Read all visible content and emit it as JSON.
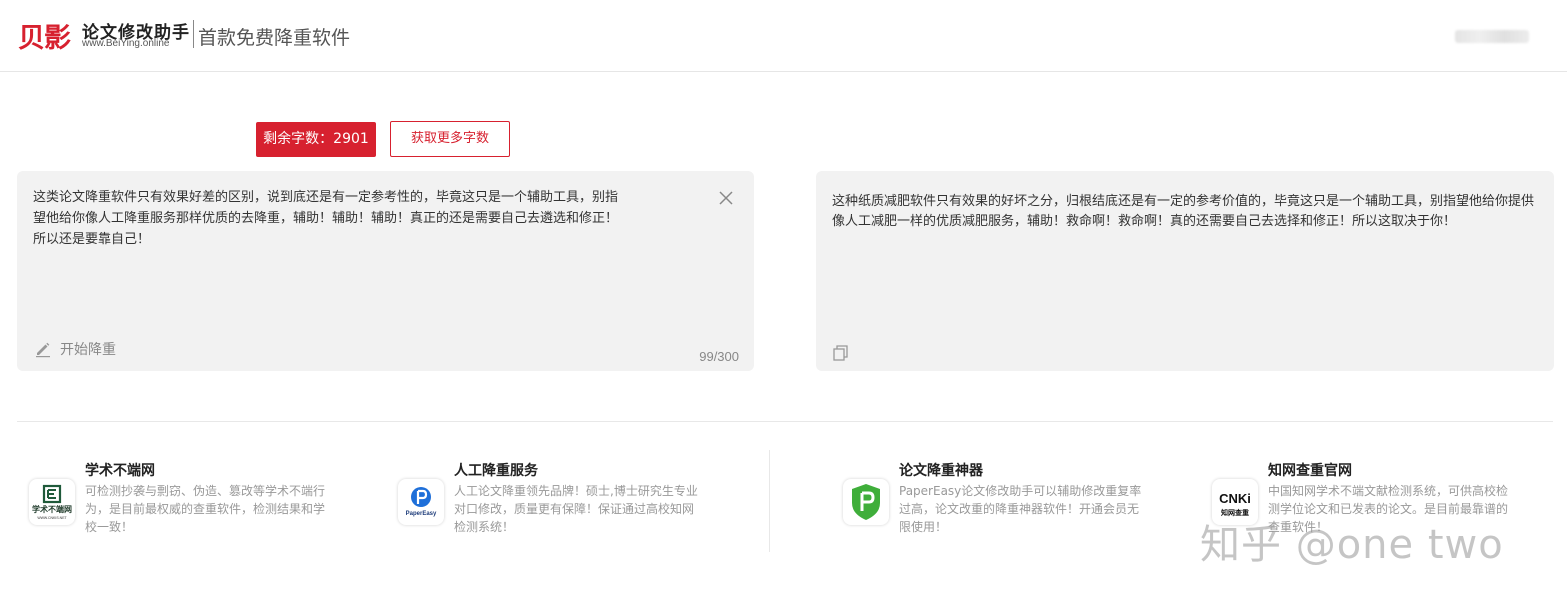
{
  "header": {
    "logo_cn": "贝影",
    "logo_title": "论文修改助手",
    "logo_url": "www.BeiYing.online",
    "tagline": "首款免费降重软件"
  },
  "toolbar": {
    "remaining_label": "剩余字数：2901",
    "get_more_label": "获取更多字数"
  },
  "input_panel": {
    "text": "这类论文降重软件只有效果好差的区别，说到底还是有一定参考性的，毕竟这只是一个辅助工具，别指\n望他给你像人工降重服务那样优质的去降重，辅助！辅助！辅助！真正的还是需要自己去遴选和修正！\n所以还是要靠自己！",
    "start_label": "开始降重",
    "counter": "99/300",
    "close_icon": "close-icon",
    "start_icon": "pencil-icon"
  },
  "output_panel": {
    "text": "这种纸质减肥软件只有效果的好坏之分，归根结底还是有一定的参考价值的，毕竟这只是一个辅助工具，别指望他给你提供像人工减肥一样的优质减肥服务，辅助！救命啊！救命啊！真的还需要自己去选择和修正！所以这取决于你！",
    "copy_icon": "copy-icon"
  },
  "footer": {
    "cards": [
      {
        "title": "学术不端网",
        "desc": "可检测抄袭与剽窃、伪造、篡改等学术不端行为，是目前最权威的查重软件，检测结果和学校一致！",
        "icon": "xueshu-logo-icon",
        "icon_text": "学术不端网",
        "icon_sub": "WWW.CNKIS.NET"
      },
      {
        "title": "人工降重服务",
        "desc": "人工论文降重领先品牌！硕士,博士研究生专业对口修改，质量更有保障！保证通过高校知网检测系统！",
        "icon": "papereasy-logo-icon",
        "icon_text": "PaperEasy"
      },
      {
        "title": "论文降重神器",
        "desc": "PaperEasy论文修改助手可以辅助修改重复率过高，论文改重的降重神器软件！开通会员无限使用！",
        "icon": "papereasy-shield-icon"
      },
      {
        "title": "知网查重官网",
        "desc": "中国知网学术不端文献检测系统，可供高校检测学位论文和已发表的论文。是目前最靠谱的查重软件！",
        "icon": "cnki-logo-icon",
        "icon_text": "CNKi",
        "icon_sub": "知网查重"
      }
    ]
  },
  "watermark": "知乎 @one two",
  "colors": {
    "accent": "#d7212f",
    "panel_bg": "#f2f2f2",
    "muted_text": "#999999"
  }
}
